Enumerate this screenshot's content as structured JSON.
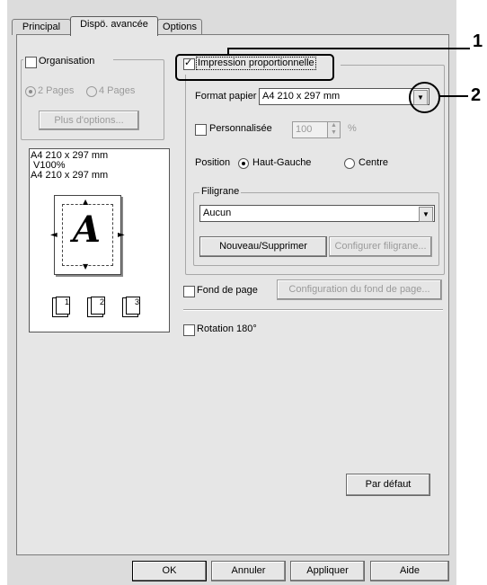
{
  "tabs": [
    "Principal",
    "Dispö. avancée",
    "Options"
  ],
  "left": {
    "organisation_label": "Organisation",
    "pages2": "2 Pages",
    "pages4": "4 Pages",
    "more_options": "Plus d'options...",
    "preview_line1": "A4 210 x 297 mm",
    "preview_line2": "V100%",
    "preview_line3": "A4 210 x 297 mm",
    "preview_letter": "A",
    "stack_numbers": [
      "1",
      "2",
      "3"
    ]
  },
  "print_scale": {
    "label": "Impression proportionnelle",
    "checked": true,
    "paper_format_label": "Format papier",
    "paper_format_value": "A4 210 x 297 mm",
    "custom_label": "Personnalisée",
    "custom_value": "100",
    "percent": "%",
    "position_label": "Position",
    "top_left": "Haut-Gauche",
    "center": "Centre"
  },
  "watermark": {
    "label": "Filigrane",
    "value": "Aucun",
    "new_delete": "Nouveau/Supprimer",
    "configure": "Configurer filigrane..."
  },
  "background": {
    "label": "Fond de page",
    "configure": "Configuration du fond de page..."
  },
  "rotation": {
    "label": "Rotation 180°"
  },
  "default_button": "Par défaut",
  "footer": {
    "ok": "OK",
    "cancel": "Annuler",
    "apply": "Appliquer",
    "help": "Aide"
  },
  "callouts": [
    "1",
    "2"
  ]
}
